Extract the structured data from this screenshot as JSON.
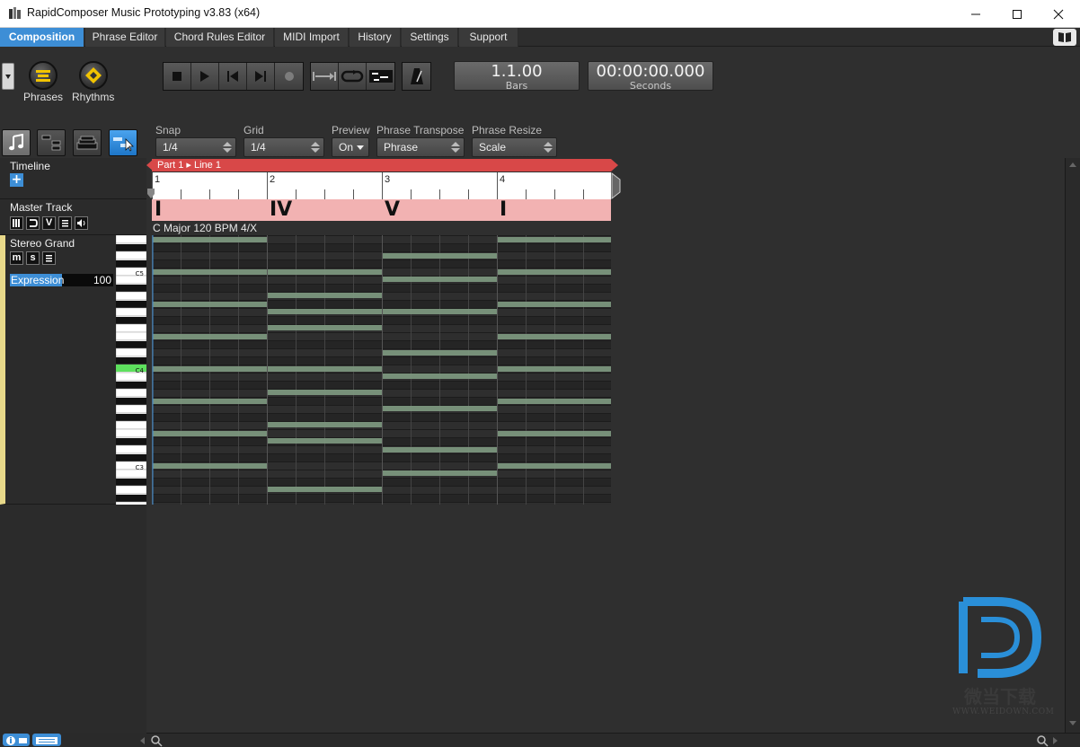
{
  "window": {
    "title": "RapidComposer Music Prototyping v3.83 (x64)"
  },
  "menu": {
    "items": [
      "Composition",
      "Phrase Editor",
      "Chord Rules Editor",
      "MIDI Import",
      "History",
      "Settings",
      "Support"
    ],
    "active": "Composition"
  },
  "toolbar": {
    "phrases_label": "Phrases",
    "rhythms_label": "Rhythms",
    "position_bars": "1.1.00",
    "position_bars_unit": "Bars",
    "position_time": "00:00:00.000",
    "position_time_unit": "Seconds"
  },
  "params": {
    "snap_label": "Snap",
    "snap_value": "1/4",
    "grid_label": "Grid",
    "grid_value": "1/4",
    "preview_label": "Preview",
    "preview_value": "On",
    "transpose_label": "Phrase Transpose",
    "transpose_value": "Phrase",
    "resize_label": "Phrase Resize",
    "resize_value": "Scale"
  },
  "tracks": {
    "timeline_label": "Timeline",
    "master_label": "Master Track",
    "master_buttons": [
      "V"
    ],
    "track_name": "Stereo Grand",
    "track_buttons": [
      "m",
      "s"
    ],
    "expression_label": "Expression",
    "expression_value": "100",
    "expression_level": 0.5
  },
  "piano": {
    "labels": [
      "C5",
      "C4",
      "C3"
    ]
  },
  "editor": {
    "part_label": "Part 1 ▸ Line 1",
    "bars": [
      "1",
      "2",
      "3",
      "4"
    ],
    "chords": [
      "I",
      "IV",
      "V",
      "I"
    ],
    "key_info": "C Major   120 BPM   4/X"
  },
  "watermark": {
    "cn": "微当下载",
    "url": "WWW.WEIDOWN.COM"
  },
  "colors": {
    "accent": "#3d8ed6",
    "part_bar": "#d84848",
    "chord_lane": "#f2b2b2",
    "track_strip": "#e8d98a",
    "note": "#7f9b82"
  }
}
